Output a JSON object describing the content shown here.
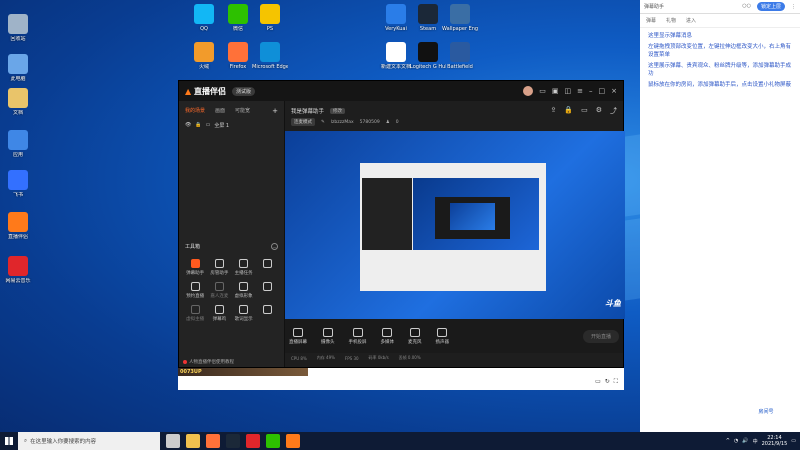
{
  "desktop": {
    "left_icons": [
      {
        "label": "回收站",
        "color": "#9fb3c8"
      },
      {
        "label": "此电脑",
        "color": "#6aa6e8"
      },
      {
        "label": "文档",
        "color": "#e9c46a"
      },
      {
        "label": "应用",
        "color": "#3f87e6"
      },
      {
        "label": "飞书",
        "color": "#3370ff"
      },
      {
        "label": "直播伴侣",
        "color": "#ff7a1a"
      },
      {
        "label": "网易云音乐",
        "color": "#e0262b"
      }
    ],
    "top_icons": [
      {
        "label": "QQ",
        "color": "#12b7f5"
      },
      {
        "label": "微信",
        "color": "#2dc100"
      },
      {
        "label": "PS",
        "color": "#f5c400"
      },
      {
        "label": "VeryKuai",
        "color": "#2a7de8"
      },
      {
        "label": "Steam",
        "color": "#1b2838"
      },
      {
        "label": "Wallpaper Engine",
        "color": "#3a6ea5"
      },
      {
        "label": "火绒",
        "color": "#f29b2b"
      },
      {
        "label": "Firefox",
        "color": "#ff7139"
      },
      {
        "label": "Microsoft Edge",
        "color": "#0f8fd8"
      },
      {
        "label": "新建文本文档",
        "color": "#ffffff"
      },
      {
        "label": "Logitech G Hub",
        "color": "#111111"
      },
      {
        "label": "Battlefield",
        "color": "#2a5aa0"
      }
    ]
  },
  "side_panel": {
    "header_title": "弹幕助手",
    "toggle_off": "",
    "toggle_on": "锁定上层",
    "tabs": [
      "弹幕",
      "礼物",
      "进入"
    ],
    "messages": [
      "这里显示弹幕消息",
      "左键拖拽顶部改变位置，左键拉伸边框改变大小，右上角有设置菜单",
      "这里展示弹幕、贵宾观众、粉丝牌升级等，添加弹幕助手成功",
      "鼠标放在你的房间，添加弹幕助手后，点击设置小礼物屏蔽"
    ]
  },
  "app": {
    "logo_text": "直播伴侣",
    "version": "测试版",
    "left_tabs": [
      "我的场景",
      "画面",
      "可能宽"
    ],
    "scene_name": "全屏 1",
    "toolbox_title": "工具箱",
    "tools": [
      {
        "label": "弹幕助手",
        "hot": true,
        "dim": false
      },
      {
        "label": "房管助手",
        "hot": false,
        "dim": false
      },
      {
        "label": "主播任务",
        "hot": false,
        "dim": false
      },
      {
        "label": "",
        "hot": false,
        "dim": false
      },
      {
        "label": "预约直播",
        "hot": false,
        "dim": false
      },
      {
        "label": "嘉人连麦",
        "hot": false,
        "dim": true
      },
      {
        "label": "虚拟形象",
        "hot": false,
        "dim": false
      },
      {
        "label": "",
        "hot": false,
        "dim": false
      },
      {
        "label": "虚拟主播",
        "hot": false,
        "dim": true
      },
      {
        "label": "弹幕鸡",
        "hot": false,
        "dim": false
      },
      {
        "label": "歌词显示",
        "hot": false,
        "dim": false
      },
      {
        "label": "",
        "hot": false,
        "dim": false
      }
    ],
    "footer_text": "人物直播伴侣使用教程",
    "room_title": "我是弹幕助手",
    "room_tag": "修改",
    "meta_tag": "连麦模式",
    "meta_user": "lzbzzzMax",
    "meta_id": "5780509",
    "meta_count": "0",
    "bottom_buttons": [
      "直播屏幕",
      "摄像头",
      "手机投屏",
      "多媒体",
      "麦克风",
      "扬声器"
    ],
    "go_live_label": "开始直播",
    "status_items": [
      "CPU 8%",
      "内存 49%",
      "FPS 30",
      "码率 0kb/s",
      "丢帧 0.00%"
    ],
    "preview_watermark": "斗鱼"
  },
  "webcam_overlay": "0073UP",
  "douyu_badge": {
    "brand": "斗鱼",
    "room_label": "房间号",
    "room_id": "5780509"
  },
  "taskbar": {
    "search_placeholder": "在这里输入你要搜索的内容",
    "pinned": [
      {
        "name": "task-view",
        "color": "#cccccc"
      },
      {
        "name": "explorer",
        "color": "#f2c14e"
      },
      {
        "name": "firefox",
        "color": "#ff7139"
      },
      {
        "name": "steam",
        "color": "#1b2838"
      },
      {
        "name": "netease-music",
        "color": "#e0262b"
      },
      {
        "name": "wechat",
        "color": "#2dc100"
      },
      {
        "name": "livemate",
        "color": "#ff7a1a"
      }
    ],
    "tray_text": "中",
    "time": "22:14",
    "date": "2021/9/15"
  }
}
